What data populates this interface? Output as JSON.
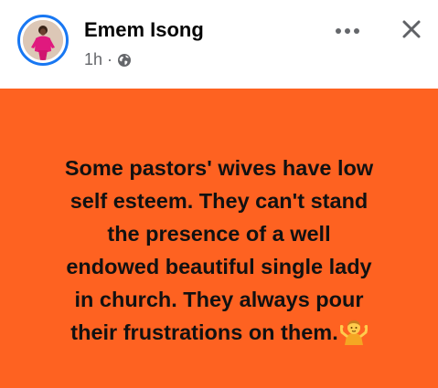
{
  "post": {
    "author_name": "Emem Isong",
    "time": "1h",
    "separator": "·",
    "privacy_icon": "globe-icon",
    "more_icon": "more-options-icon",
    "close_icon": "close-icon",
    "background_color": "#fe6221",
    "text_lines": [
      "Some pastors' wives have low",
      "self esteem. They can't stand",
      "the presence of a well",
      "endowed beautiful single lady",
      "in church. They always pour",
      "their frustrations on them."
    ],
    "trailing_emoji": "person-shrugging-emoji"
  },
  "colors": {
    "avatar_ring": "#1877f2",
    "name": "#050505",
    "meta": "#65676b",
    "card": "#fe6221"
  }
}
